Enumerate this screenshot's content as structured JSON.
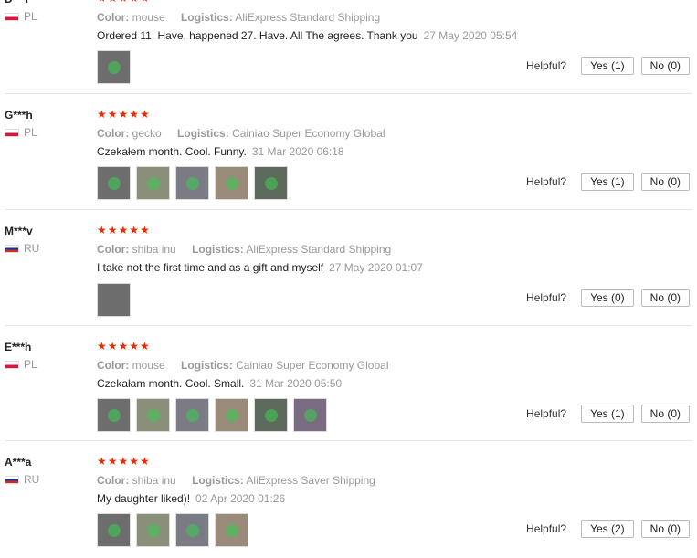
{
  "labels": {
    "color": "Color:",
    "logistics": "Logistics:",
    "helpful": "Helpful?"
  },
  "reviews": [
    {
      "user": "D***l",
      "country": "PL",
      "stars": "★★★★★",
      "color": "mouse",
      "logistics": "AliExpress Standard Shipping",
      "text": "Ordered 11. Have, happened 27. Have. All The agrees. Thank you",
      "date": "27 May 2020 05:54",
      "yes": "Yes (1)",
      "no": "No (0)",
      "thumbs": 1
    },
    {
      "user": "G***h",
      "country": "PL",
      "stars": "★★★★★",
      "color": "gecko",
      "logistics": "Cainiao Super Economy Global",
      "text": "Czekałem month. Cool. Funny.",
      "date": "31 Mar 2020 06:18",
      "yes": "Yes (1)",
      "no": "No (0)",
      "thumbs": 5
    },
    {
      "user": "M***v",
      "country": "RU",
      "stars": "★★★★★",
      "color": "shiba inu",
      "logistics": "AliExpress Standard Shipping",
      "text": "I take not the first time and as a gift and myself",
      "date": "27 May 2020 01:07",
      "yes": "Yes (0)",
      "no": "No (0)",
      "thumbs": 1
    },
    {
      "user": "E***h",
      "country": "PL",
      "stars": "★★★★★",
      "color": "mouse",
      "logistics": "Cainiao Super Economy Global",
      "text": "Czekałam month. Cool. Small.",
      "date": "31 Mar 2020 05:50",
      "yes": "Yes (1)",
      "no": "No (0)",
      "thumbs": 6
    },
    {
      "user": "A***a",
      "country": "RU",
      "stars": "★★★★★",
      "color": "shiba inu",
      "logistics": "AliExpress Saver Shipping",
      "text": "My daughter liked)!",
      "date": "02 Apr 2020 01:26",
      "yes": "Yes (2)",
      "no": "No (0)",
      "thumbs": 4
    }
  ]
}
